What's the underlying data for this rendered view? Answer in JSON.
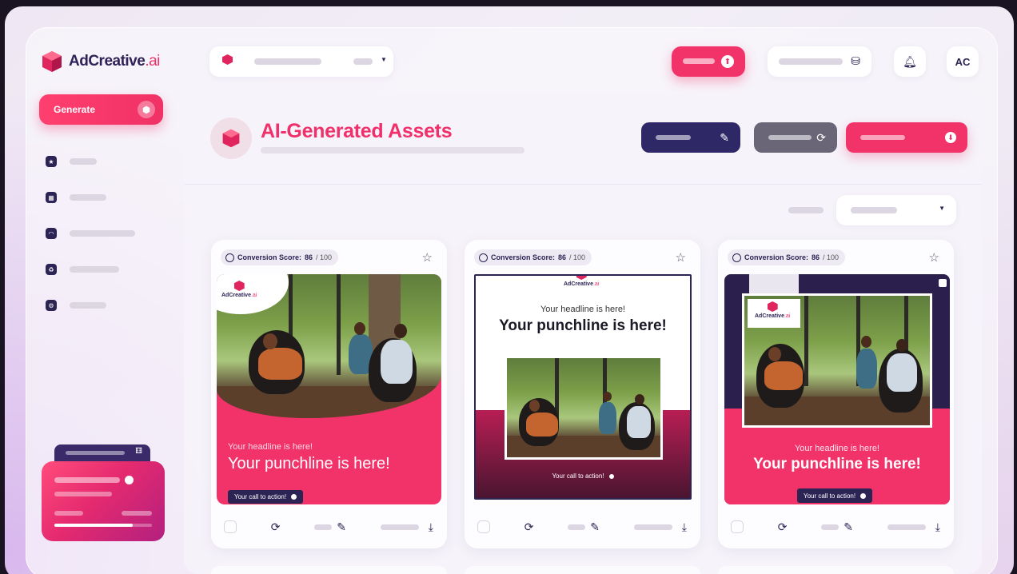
{
  "brand": {
    "name_main": "AdCreative",
    "name_suffix": ".ai",
    "accent": "#f0306a",
    "navy": "#2b2454"
  },
  "sidebar": {
    "generate_label": "Generate",
    "nav_icons": [
      "star-icon",
      "grid-icon",
      "gauge-icon",
      "recycle-icon",
      "gear-icon"
    ]
  },
  "header": {
    "avatar_initials": "AC"
  },
  "page": {
    "title": "AI-Generated Assets"
  },
  "cards": [
    {
      "score_label": "Conversion Score:",
      "score_value": "86",
      "score_max": "/ 100",
      "headline": "Your headline is here!",
      "punchline": "Your punchline is here!",
      "cta": "Your call to action!",
      "logo_main": "AdCreative",
      "logo_suffix": ".ai"
    },
    {
      "score_label": "Conversion Score:",
      "score_value": "86",
      "score_max": "/ 100",
      "headline": "Your headline is here!",
      "punchline": "Your punchline is here!",
      "cta": "Your call to action!",
      "logo_main": "AdCreative",
      "logo_suffix": ".ai"
    },
    {
      "score_label": "Conversion Score:",
      "score_value": "86",
      "score_max": "/ 100",
      "headline": "Your headline is here!",
      "punchline": "Your punchline is here!",
      "cta": "Your call to action!",
      "logo_main": "AdCreative",
      "logo_suffix": ".ai"
    }
  ],
  "credits": {
    "progress": 0.8
  }
}
